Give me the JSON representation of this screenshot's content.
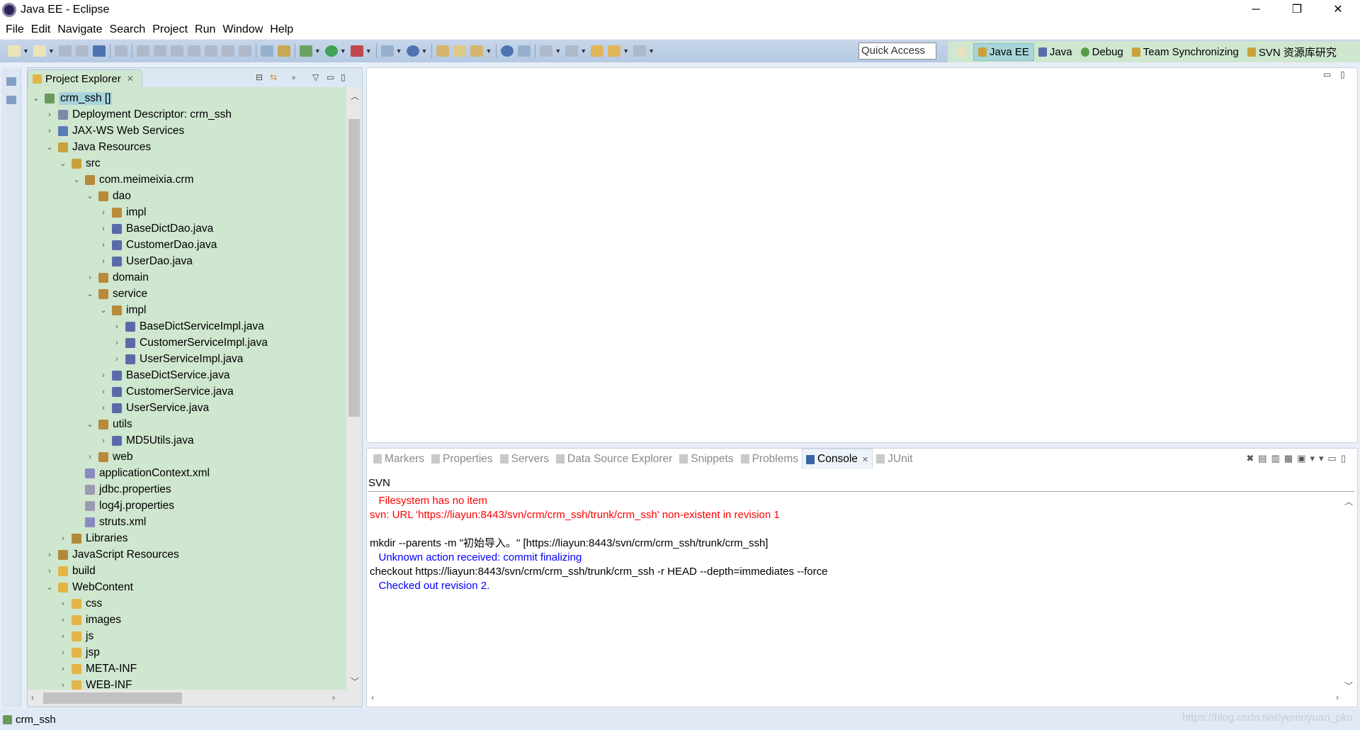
{
  "window": {
    "title": "Java EE - Eclipse",
    "controls": [
      "─",
      "❐",
      "✕"
    ]
  },
  "menu": [
    "File",
    "Edit",
    "Navigate",
    "Search",
    "Project",
    "Run",
    "Window",
    "Help"
  ],
  "toolbar": {
    "quick_access": "Quick Access"
  },
  "perspectives": [
    {
      "label": "Java EE",
      "active": true
    },
    {
      "label": "Java",
      "active": false
    },
    {
      "label": "Debug",
      "active": false
    },
    {
      "label": "Team Synchronizing",
      "active": false
    },
    {
      "label": "SVN 资源库研究",
      "active": false
    }
  ],
  "project_explorer": {
    "title": "Project Explorer",
    "tree": [
      {
        "label": "crm_ssh []",
        "depth": 0,
        "state": "open",
        "selected": true,
        "icon": "project"
      },
      {
        "label": "Deployment Descriptor: crm_ssh",
        "depth": 1,
        "state": "closed",
        "icon": "descriptor"
      },
      {
        "label": "JAX-WS Web Services",
        "depth": 1,
        "state": "closed",
        "icon": "webservice"
      },
      {
        "label": "Java Resources",
        "depth": 1,
        "state": "open",
        "icon": "resources"
      },
      {
        "label": "src",
        "depth": 2,
        "state": "open",
        "icon": "source-folder"
      },
      {
        "label": "com.meimeixia.crm",
        "depth": 3,
        "state": "open",
        "icon": "package"
      },
      {
        "label": "dao",
        "depth": 4,
        "state": "open",
        "icon": "package"
      },
      {
        "label": "impl",
        "depth": 5,
        "state": "closed",
        "icon": "package"
      },
      {
        "label": "BaseDictDao.java",
        "depth": 5,
        "state": "closed",
        "icon": "java-file"
      },
      {
        "label": "CustomerDao.java",
        "depth": 5,
        "state": "closed",
        "icon": "java-file"
      },
      {
        "label": "UserDao.java",
        "depth": 5,
        "state": "closed",
        "icon": "java-file"
      },
      {
        "label": "domain",
        "depth": 4,
        "state": "closed",
        "icon": "package"
      },
      {
        "label": "service",
        "depth": 4,
        "state": "open",
        "icon": "package"
      },
      {
        "label": "impl",
        "depth": 5,
        "state": "open",
        "icon": "package"
      },
      {
        "label": "BaseDictServiceImpl.java",
        "depth": 6,
        "state": "closed",
        "icon": "java-file"
      },
      {
        "label": "CustomerServiceImpl.java",
        "depth": 6,
        "state": "closed",
        "icon": "java-file"
      },
      {
        "label": "UserServiceImpl.java",
        "depth": 6,
        "state": "closed",
        "icon": "java-file"
      },
      {
        "label": "BaseDictService.java",
        "depth": 5,
        "state": "closed",
        "icon": "java-file"
      },
      {
        "label": "CustomerService.java",
        "depth": 5,
        "state": "closed",
        "icon": "java-file"
      },
      {
        "label": "UserService.java",
        "depth": 5,
        "state": "closed",
        "icon": "java-file"
      },
      {
        "label": "utils",
        "depth": 4,
        "state": "open",
        "icon": "package"
      },
      {
        "label": "MD5Utils.java",
        "depth": 5,
        "state": "closed",
        "icon": "java-file"
      },
      {
        "label": "web",
        "depth": 4,
        "state": "closed",
        "icon": "package"
      },
      {
        "label": "applicationContext.xml",
        "depth": 3,
        "state": "leaf",
        "icon": "xml-file"
      },
      {
        "label": "jdbc.properties",
        "depth": 3,
        "state": "leaf",
        "icon": "properties-file"
      },
      {
        "label": "log4j.properties",
        "depth": 3,
        "state": "leaf",
        "icon": "properties-file"
      },
      {
        "label": "struts.xml",
        "depth": 3,
        "state": "leaf",
        "icon": "xml-file"
      },
      {
        "label": "Libraries",
        "depth": 2,
        "state": "closed",
        "icon": "library"
      },
      {
        "label": "JavaScript Resources",
        "depth": 1,
        "state": "closed",
        "icon": "library"
      },
      {
        "label": "build",
        "depth": 1,
        "state": "closed",
        "icon": "folder"
      },
      {
        "label": "WebContent",
        "depth": 1,
        "state": "open",
        "icon": "folder"
      },
      {
        "label": "css",
        "depth": 2,
        "state": "closed",
        "icon": "folder"
      },
      {
        "label": "images",
        "depth": 2,
        "state": "closed",
        "icon": "folder"
      },
      {
        "label": "js",
        "depth": 2,
        "state": "closed",
        "icon": "folder"
      },
      {
        "label": "jsp",
        "depth": 2,
        "state": "closed",
        "icon": "folder"
      },
      {
        "label": "META-INF",
        "depth": 2,
        "state": "closed",
        "icon": "folder"
      },
      {
        "label": "WEB-INF",
        "depth": 2,
        "state": "closed",
        "icon": "folder"
      }
    ]
  },
  "bottom_panel": {
    "tabs": [
      {
        "label": "Markers",
        "active": false
      },
      {
        "label": "Properties",
        "active": false
      },
      {
        "label": "Servers",
        "active": false
      },
      {
        "label": "Data Source Explorer",
        "active": false
      },
      {
        "label": "Snippets",
        "active": false
      },
      {
        "label": "Problems",
        "active": false
      },
      {
        "label": "Console",
        "active": true
      },
      {
        "label": "JUnit",
        "active": false
      }
    ],
    "console_name": "SVN",
    "lines": [
      {
        "text": "   Filesystem has no item",
        "color": "#ff0000"
      },
      {
        "text": "svn: URL 'https://liayun:8443/svn/crm/crm_ssh/trunk/crm_ssh' non-existent in revision 1",
        "color": "#ff0000"
      },
      {
        "text": "",
        "color": "#000000"
      },
      {
        "text": "mkdir --parents -m \"初始导入。\" [https://liayun:8443/svn/crm/crm_ssh/trunk/crm_ssh]",
        "color": "#000000"
      },
      {
        "text": "   Unknown action received: commit finalizing",
        "color": "#0000ff"
      },
      {
        "text": "checkout https://liayun:8443/svn/crm/crm_ssh/trunk/crm_ssh -r HEAD --depth=immediates --force",
        "color": "#000000"
      },
      {
        "text": "   Checked out revision 2.",
        "color": "#0000ff"
      }
    ]
  },
  "status": {
    "selected": "crm_ssh",
    "watermark": "https://blog.csdn.net/yerenyuan_pku"
  }
}
